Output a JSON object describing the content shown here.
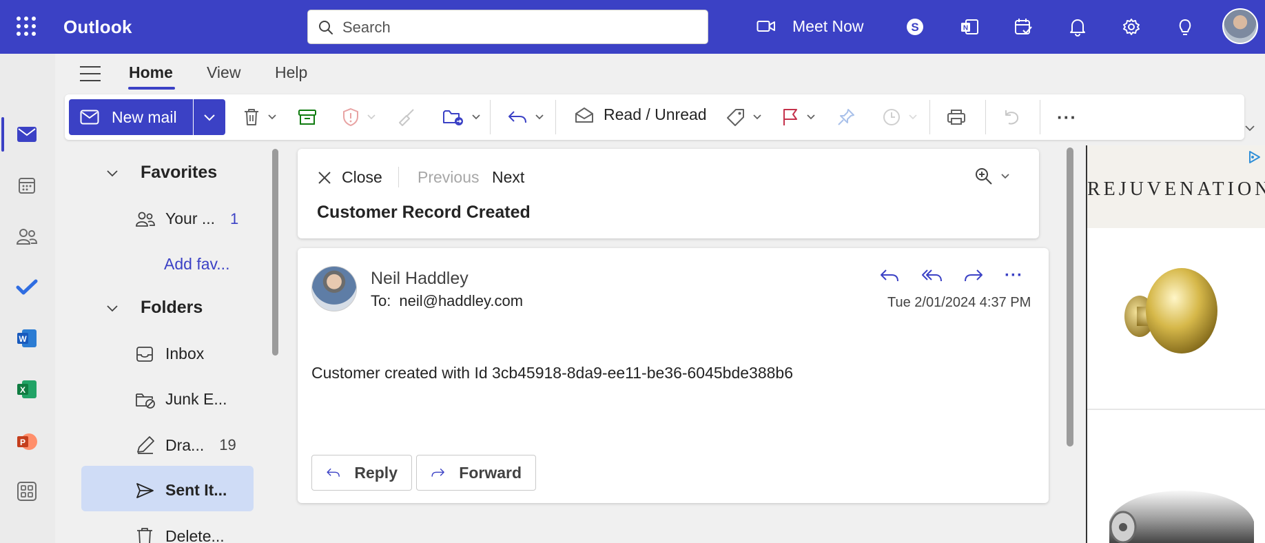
{
  "app": {
    "title": "Outlook"
  },
  "search": {
    "placeholder": "Search"
  },
  "topbar": {
    "meet_now_label": "Meet Now",
    "icons": [
      "video-icon",
      "skype-icon",
      "onenote-icon",
      "calendar-check-icon",
      "bell-icon",
      "gear-icon",
      "lightbulb-icon"
    ]
  },
  "rail": {
    "items": [
      "mail",
      "calendar",
      "people",
      "todo",
      "word",
      "excel",
      "powerpoint",
      "apps"
    ]
  },
  "tabs": [
    {
      "label": "Home"
    },
    {
      "label": "View"
    },
    {
      "label": "Help"
    }
  ],
  "ribbon": {
    "new_mail_label": "New mail",
    "read_unread_label": "Read / Unread",
    "more_label": "···"
  },
  "folders": {
    "favorites_label": "Favorites",
    "favorite_items": [
      {
        "label": "Your ...",
        "count": "1"
      }
    ],
    "add_favorite_label": "Add fav...",
    "folders_label": "Folders",
    "items": [
      {
        "label": "Inbox",
        "count": ""
      },
      {
        "label": "Junk E...",
        "count": ""
      },
      {
        "label": "Dra...",
        "count": "19"
      },
      {
        "label": "Sent It...",
        "count": ""
      },
      {
        "label": "Delete...",
        "count": ""
      }
    ]
  },
  "reading": {
    "close_label": "Close",
    "previous_label": "Previous",
    "next_label": "Next",
    "subject": "Customer Record Created",
    "sender_name": "Neil Haddley",
    "to_label": "To:",
    "to_address": "neil@haddley.com",
    "date": "Tue 2/01/2024 4:37 PM",
    "more_actions_label": "···",
    "body": "Customer created with Id 3cb45918-8da9-ee11-be36-6045bde388b6",
    "reply_label": "Reply",
    "forward_label": "Forward"
  },
  "ad": {
    "brand": "REJUVENATION"
  },
  "colors": {
    "brand": "#3b41c5",
    "selected": "#cfdcf6",
    "flag": "#c4314b",
    "archive": "#0f7b0f"
  }
}
